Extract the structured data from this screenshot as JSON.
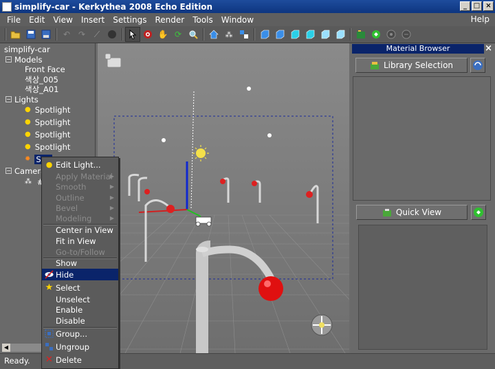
{
  "window": {
    "title": "simplify-car - Kerkythea 2008 Echo Edition",
    "controls": [
      "_",
      "□",
      "×"
    ]
  },
  "menu": {
    "items": [
      "File",
      "Edit",
      "View",
      "Insert",
      "Settings",
      "Render",
      "Tools",
      "Window"
    ],
    "help": "Help"
  },
  "toolbar": {
    "icons": [
      "open-icon",
      "save-icon",
      "save-as-icon",
      "undo-icon",
      "redo-icon",
      "wand-icon",
      "sphere-icon",
      "select-icon",
      "target-icon",
      "pan-icon",
      "rotate-icon",
      "zoom-icon",
      "home-icon",
      "camera-icon",
      "fit-icon",
      "cube-front-icon",
      "cube-back-icon",
      "cube-left-icon",
      "cube-right-icon",
      "cube-top-icon",
      "cube-bottom-icon",
      "render-icon",
      "green-gear-icon",
      "gear-icon",
      "gear2-icon"
    ]
  },
  "tree": {
    "root": "simplify-car",
    "models_label": "Models",
    "models": [
      "Front Face",
      "색상_005",
      "색상_A01"
    ],
    "lights_label": "Lights",
    "lights": [
      "Spotlight",
      "Spotlight",
      "Spotlight",
      "Spotlight"
    ],
    "sun_partial": "Sun",
    "cameras_label": "Camera",
    "camera_item_partial": "#"
  },
  "context_menu": {
    "edit_light": "Edit Light...",
    "apply_material": "Apply Material",
    "smooth": "Smooth",
    "outline": "Outline",
    "bevel": "Bevel",
    "modeling": "Modeling",
    "center_in_view": "Center in View",
    "fit_in_view": "Fit in View",
    "go_to_follow": "Go-to/Follow",
    "show": "Show",
    "hide": "Hide",
    "select": "Select",
    "unselect": "Unselect",
    "enable": "Enable",
    "disable": "Disable",
    "group": "Group...",
    "ungroup": "Ungroup",
    "delete": "Delete"
  },
  "material_browser": {
    "title": "Material Browser",
    "library_selection": "Library Selection",
    "quick_view": "Quick View"
  },
  "status": {
    "text": "Ready."
  },
  "colors": {
    "title_bar": "#0d3580",
    "selection": "#0a246a",
    "panel": "#6a6a6a",
    "viewport_bg": "#7d7d7d"
  }
}
